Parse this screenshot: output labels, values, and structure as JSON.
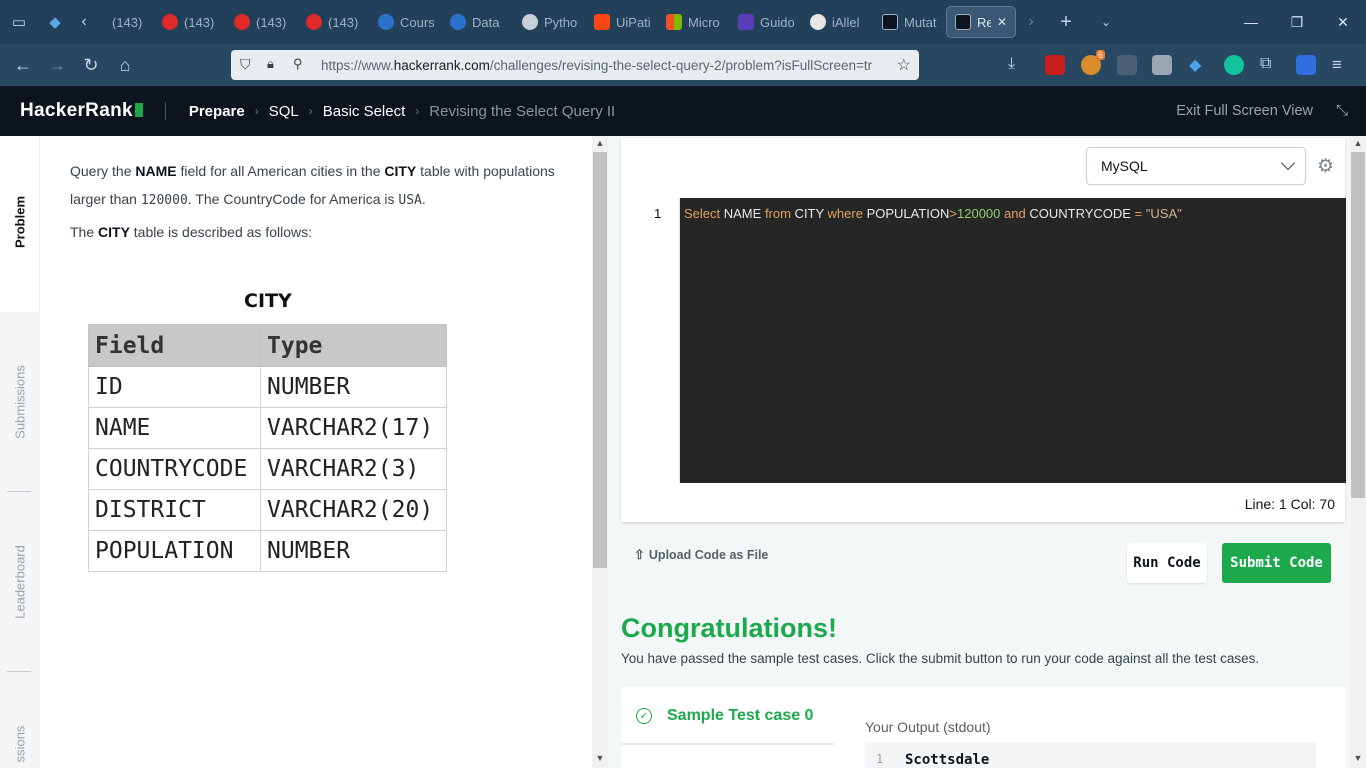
{
  "browser": {
    "tabs": [
      {
        "label": "(143)",
        "icon": "youtube-icon"
      },
      {
        "label": "(143)",
        "icon": "youtube-icon"
      },
      {
        "label": "(143)",
        "icon": "youtube-icon"
      },
      {
        "label": "(143)",
        "icon": "youtube-icon"
      },
      {
        "label": "Cours",
        "icon": "coursera-icon"
      },
      {
        "label": "Data",
        "icon": "coursera-icon"
      },
      {
        "label": "Pytho",
        "icon": "openai-icon"
      },
      {
        "label": "UiPati",
        "icon": "uipath-icon"
      },
      {
        "label": "Micro",
        "icon": "microsoft-icon"
      },
      {
        "label": "Guido",
        "icon": "bracket-icon"
      },
      {
        "label": "iAllel",
        "icon": "github-icon"
      },
      {
        "label": "Mutat",
        "icon": "hackerrank-icon"
      },
      {
        "label": "Re",
        "icon": "hackerrank-icon"
      }
    ],
    "url_prefix": "https://www.",
    "url_domain": "hackerrank.com",
    "url_path": "/challenges/revising-the-select-query-2/problem?isFullScreen=tr",
    "extension_badge": "6"
  },
  "header": {
    "logo": "HackerRank",
    "breadcrumbs": [
      "Prepare",
      "SQL",
      "Basic Select"
    ],
    "current": "Revising the Select Query II",
    "exit_fullscreen": "Exit Full Screen View"
  },
  "sidebar": {
    "tabs": [
      "Problem",
      "Submissions",
      "Leaderboard",
      "ssions"
    ]
  },
  "problem": {
    "p1_a": "Query the ",
    "p1_b": "NAME",
    "p1_c": " field for all American cities in the ",
    "p1_d": "CITY",
    "p1_e": " table with populations larger than ",
    "p1_f": "120000",
    "p1_g": ". The CountryCode for America is ",
    "p1_h": "USA",
    "p1_i": ".",
    "p2_a": "The ",
    "p2_b": "CITY",
    "p2_c": " table is described as follows:",
    "table_title": "CITY",
    "table_headers": [
      "Field",
      "Type"
    ],
    "table_rows": [
      [
        "ID",
        "NUMBER"
      ],
      [
        "NAME",
        "VARCHAR2(17)"
      ],
      [
        "COUNTRYCODE",
        "VARCHAR2(3)"
      ],
      [
        "DISTRICT",
        "VARCHAR2(20)"
      ],
      [
        "POPULATION",
        "NUMBER"
      ]
    ]
  },
  "editor": {
    "language": "MySQL",
    "line_number": "1",
    "code_tokens": {
      "t1": "Select",
      "t2": " NAME ",
      "t3": "from",
      "t4": " CITY ",
      "t5": "where",
      "t6": " POPULATION",
      "t7": ">",
      "t8": "120000",
      "t9": " ",
      "t10": "and",
      "t11": " COUNTRYCODE ",
      "t12": "=",
      "t13": " ",
      "t14": "\"USA\""
    },
    "status": "Line: 1 Col: 70",
    "upload_label": "Upload Code as File",
    "run_label": "Run Code",
    "submit_label": "Submit Code"
  },
  "result": {
    "title": "Congratulations!",
    "message": "You have passed the sample test cases. Click the submit button to run your code against all the test cases.",
    "testcase_label": "Sample Test case 0",
    "output_label": "Your Output (stdout)",
    "output_line_no": "1",
    "output_first_line": "Scottsdale"
  },
  "colors": {
    "accent": "#1ba94c",
    "header_bg": "#0e141e",
    "editor_bg": "#262626"
  }
}
